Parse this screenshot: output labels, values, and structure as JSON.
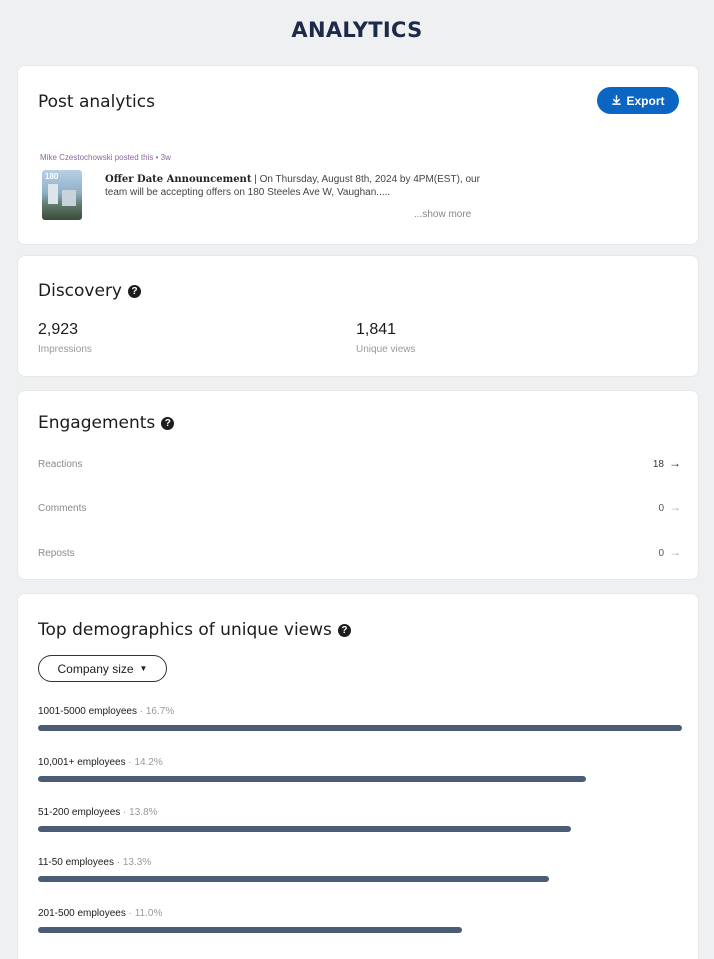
{
  "header": {
    "title": "ANALYTICS"
  },
  "post_analytics": {
    "title": "Post analytics",
    "export_label": "Export",
    "post_meta": "Mike Czestochowski posted this • 3w",
    "post_title": "Offer Date Announcement",
    "post_text": " | On Thursday, August 8th, 2024 by 4PM(EST), our team will be accepting offers on 180 Steeles Ave W, Vaughan.....",
    "show_more": "...show more",
    "thumbnail_tag": "180"
  },
  "discovery": {
    "title": "Discovery",
    "impressions_value": "2,923",
    "impressions_label": "Impressions",
    "unique_views_value": "1,841",
    "unique_views_label": "Unique views"
  },
  "engagements": {
    "title": "Engagements",
    "rows": [
      {
        "label": "Reactions",
        "count": "18"
      },
      {
        "label": "Comments",
        "count": "0"
      },
      {
        "label": "Reposts",
        "count": "0"
      }
    ]
  },
  "demographics": {
    "title": "Top demographics of unique views",
    "filter_label": "Company size",
    "rows": [
      {
        "label": "1001-5000 employees",
        "pct": "16.7%",
        "fraction": 1.0
      },
      {
        "label": "10,001+ employees",
        "pct": "14.2%",
        "fraction": 0.851
      },
      {
        "label": "51-200 employees",
        "pct": "13.8%",
        "fraction": 0.827
      },
      {
        "label": "11-50 employees",
        "pct": "13.3%",
        "fraction": 0.793
      },
      {
        "label": "201-500 employees",
        "pct": "11.0%",
        "fraction": 0.658
      }
    ]
  },
  "icons": {
    "help": "question-circle-icon",
    "export": "download-icon",
    "arrow": "arrow-right-icon",
    "caret": "caret-down-icon"
  },
  "colors": {
    "accent": "#0a66c2",
    "bar": "#4a5d74",
    "header_text": "#1e2a4a"
  }
}
